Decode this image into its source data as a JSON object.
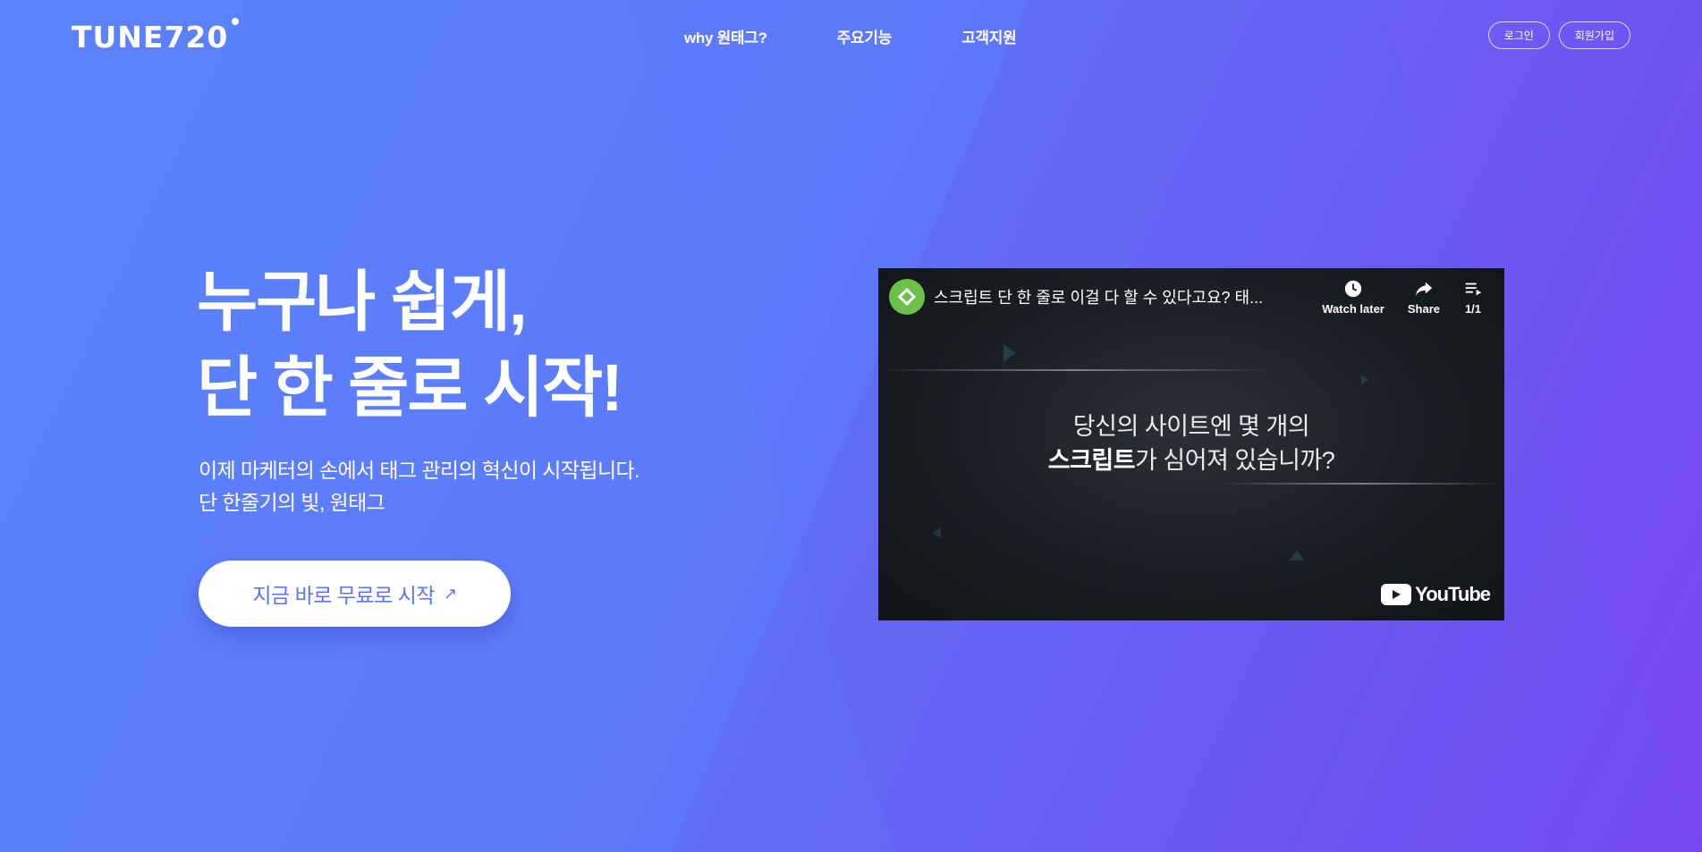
{
  "header": {
    "logo": "TUNE720",
    "nav": [
      {
        "label": "why 원태그?"
      },
      {
        "label": "주요기능"
      },
      {
        "label": "고객지원"
      }
    ],
    "login_label": "로그인",
    "signup_label": "회원가입"
  },
  "hero": {
    "title_line1": "누구나 쉽게,",
    "title_line2": "단 한 줄로 시작!",
    "subtitle_line1": "이제 마케터의 손에서 태그 관리의 혁신이 시작됩니다.",
    "subtitle_line2": "단 한줄기의 빛, 원태그",
    "cta_label": "지금 바로 무료로 시작",
    "cta_icon": "arrow-up-right-icon"
  },
  "video": {
    "title": "스크립트 단 한 줄로 이걸 다 할 수 있다고요? 태...",
    "watch_later_label": "Watch later",
    "share_label": "Share",
    "playlist_label": "1/1",
    "caption_line1": "당신의 사이트엔 몇 개의",
    "caption_strong": "스크립트",
    "caption_rest": "가 심어져 있습니까?",
    "youtube_label": "YouTube"
  },
  "colors": {
    "bg_start": "#5b82fd",
    "bg_end": "#7a46ef",
    "cta_text": "#5b74f6",
    "channel_green": "#6cc04a"
  }
}
